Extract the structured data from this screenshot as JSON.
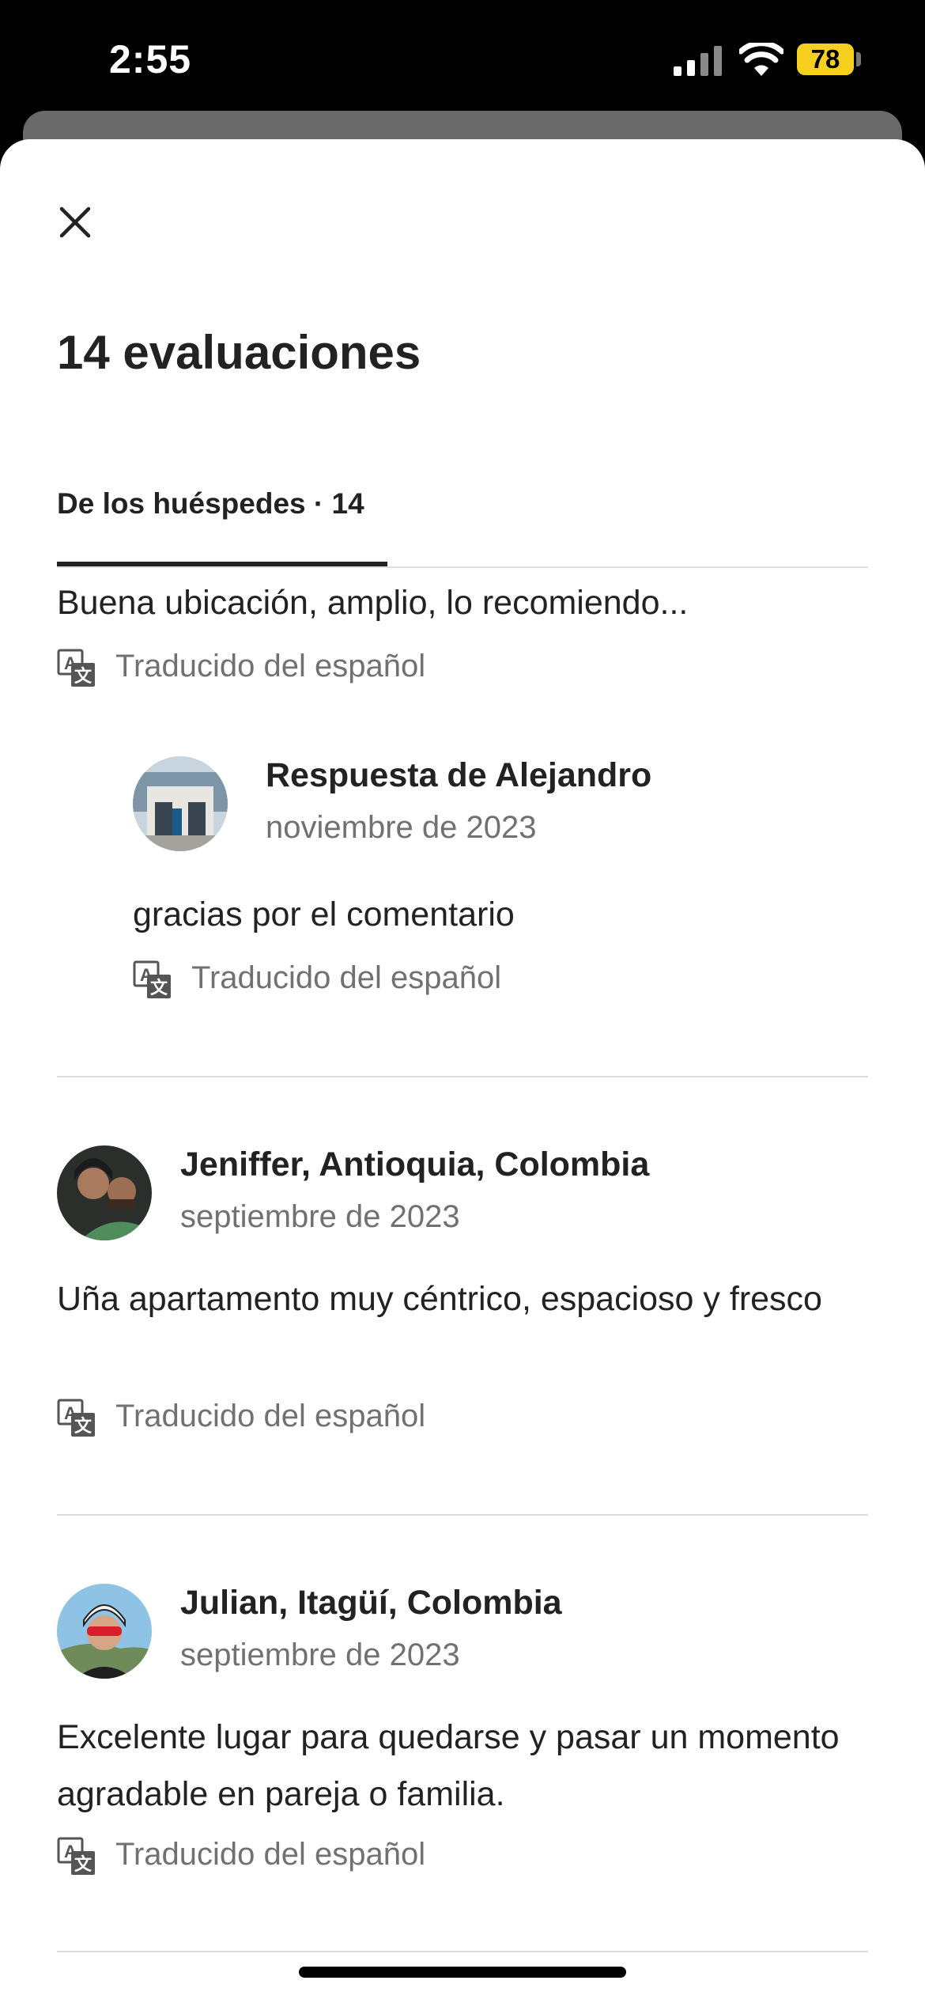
{
  "status_bar": {
    "time": "2:55",
    "battery": "78"
  },
  "sheet": {
    "close_icon": "close-icon",
    "title": "14 evaluaciones",
    "tab_label": "De los huéspedes · 14"
  },
  "reviews": {
    "partial_text": "Buena ubicación, amplio, lo recomiendo...",
    "translated_label": "Traducido del español",
    "host_response": {
      "name": "Respuesta de Alejandro",
      "date": "noviembre de 2023",
      "text": "gracias por el comentario",
      "translated_label": "Traducido del español"
    },
    "items": [
      {
        "name": "Jeniffer, Antioquia, Colombia",
        "date": "septiembre de 2023",
        "text": "Uña apartamento muy céntrico, espacioso y fresco",
        "translated_label": "Traducido del español"
      },
      {
        "name": "Julian, Itagüí, Colombia",
        "date": "septiembre de 2023",
        "text": "Excelente lugar para quedarse y pasar un momento agradable en pareja o familia.",
        "translated_label": "Traducido del español"
      }
    ]
  },
  "icons": {
    "translate": "translate-icon",
    "signal": "cellular-signal-icon",
    "wifi": "wifi-icon",
    "battery": "battery-icon"
  },
  "colors": {
    "text_primary": "#222222",
    "text_secondary": "#717171",
    "battery": "#f7cf1f"
  }
}
